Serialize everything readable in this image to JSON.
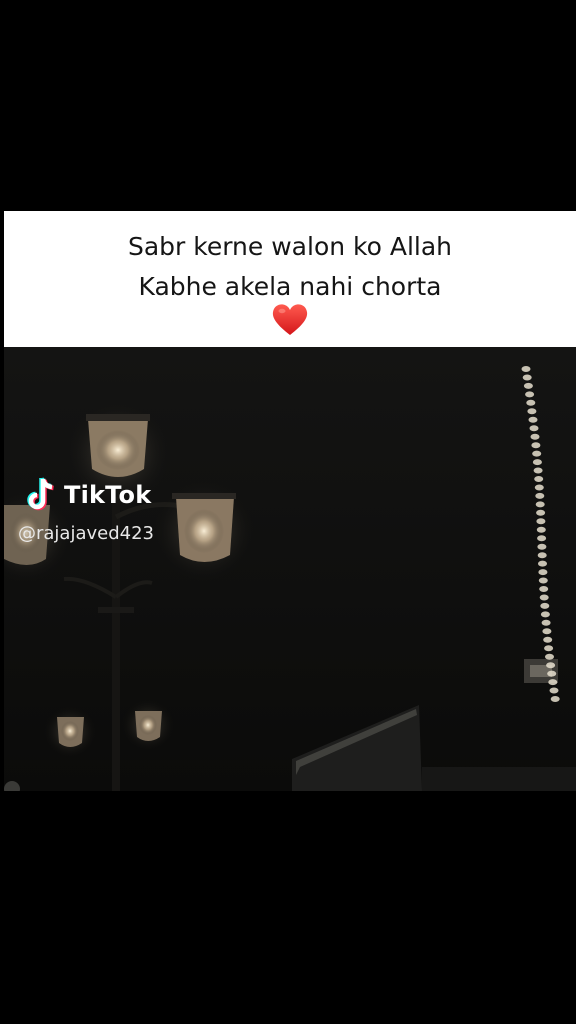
{
  "caption": {
    "line1": "Sabr kerne walon ko Allah",
    "line2": "Kabhe akela nahi chorta",
    "emoji": "heart-icon"
  },
  "watermark": {
    "brand": "TikTok",
    "handle": "@rajajaved423",
    "logo": "tiktok-logo-icon"
  },
  "colors": {
    "background": "#000000",
    "caption_background": "#ffffff",
    "caption_text": "#151515",
    "heart": "#e0201f",
    "lamp_glow": "#f3e1c6"
  }
}
